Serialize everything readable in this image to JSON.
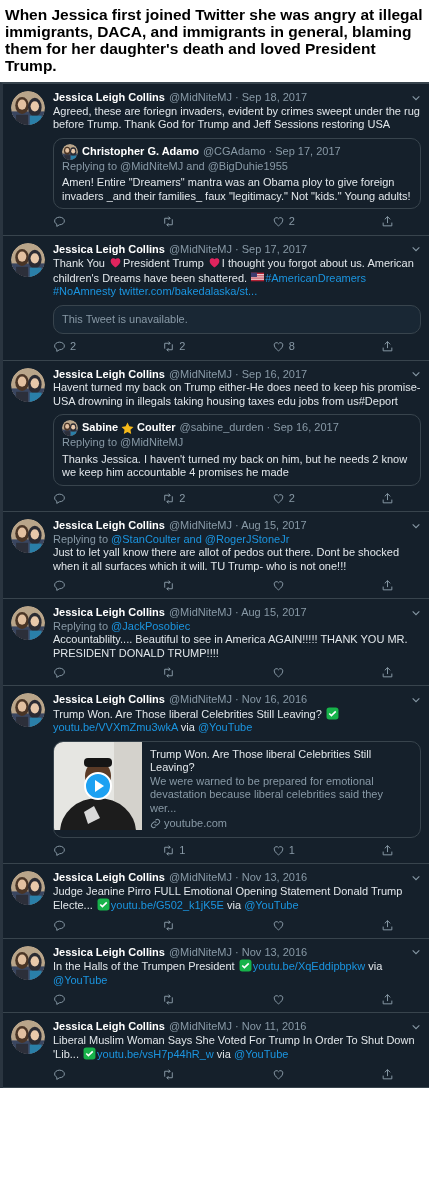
{
  "caption": "When Jessica first joined Twitter she was angry at illegal immigrants, DACA, and immigrants in general, blaming them for her daughter's death and loved President Trump.",
  "tweets": [
    {
      "author": "Jessica Leigh Collins",
      "meta": "@MidNiteMJ · Sep 18, 2017",
      "text": [
        {
          "kind": "text",
          "text": "Agreed, these are foriegn invaders, evident by crimes sweept under the rug before Trump. Thank God for Trump and Jeff Sessions restoring USA"
        }
      ],
      "quote": {
        "author": [
          {
            "kind": "text",
            "text": "Christopher G. Adamo"
          }
        ],
        "meta": "@CGAdamo · Sep 17, 2017",
        "replying": [
          {
            "kind": "text",
            "text": "Replying to @MidNiteMJ and @BigDuhie1955"
          }
        ],
        "text": "Amen! Entire \"Dreamers\" mantra was an Obama ploy to give foreign invaders _and their families_ faux \"legitimacy.\" Not \"kids.\" Young adults!"
      },
      "actions": {
        "likes": "2"
      }
    },
    {
      "author": "Jessica Leigh Collins",
      "meta": "@MidNiteMJ · Sep 17, 2017",
      "text": [
        {
          "kind": "text",
          "text": "Thank You "
        },
        {
          "kind": "heart"
        },
        {
          "kind": "text",
          "text": "President Trump "
        },
        {
          "kind": "heart"
        },
        {
          "kind": "text",
          "text": "I thought you forgot about us. American children's Dreams have been shattered. "
        },
        {
          "kind": "flag"
        },
        {
          "kind": "link",
          "text": "#AmericanDreamers"
        },
        {
          "kind": "link",
          "text": "#NoAmnesty"
        },
        {
          "kind": "link",
          "text": "twitter.com/bakedalaska/st..."
        }
      ],
      "unavailable": "This Tweet is unavailable.",
      "actions": {
        "replies": "2",
        "retweets": "2",
        "likes": "8"
      }
    },
    {
      "author": "Jessica Leigh Collins",
      "meta": "@MidNiteMJ · Sep 16, 2017",
      "text": [
        {
          "kind": "text",
          "text": "Havent turned my back on Trump either-He does need to keep his promise-USA drowning in illegals taking housing taxes edu jobs from us#Deport"
        }
      ],
      "quote": {
        "author": [
          {
            "kind": "text",
            "text": "Sabine "
          },
          {
            "kind": "star"
          },
          {
            "kind": "text",
            "text": "Coulter"
          }
        ],
        "meta": "@sabine_durden · Sep 16, 2017",
        "replying": [
          {
            "kind": "text",
            "text": "Replying to @MidNiteMJ"
          }
        ],
        "text": "Thanks Jessica. I haven't turned my back on him, but he needs 2 know we keep him accountable 4 promises he made"
      },
      "actions": {
        "retweets": "2",
        "likes": "2"
      }
    },
    {
      "author": "Jessica Leigh Collins",
      "meta": "@MidNiteMJ · Aug 15, 2017",
      "replying": [
        {
          "kind": "text",
          "text": "Replying to "
        },
        {
          "kind": "link",
          "text": "@StanCoulter and @RogerJStoneJr"
        }
      ],
      "text": [
        {
          "kind": "text",
          "text": "Just to let yall know there are allot of pedos out there. Dont be shocked when it all surfaces which it will. TU Trump- who is not one!!!"
        }
      ]
    },
    {
      "author": "Jessica Leigh Collins",
      "meta": "@MidNiteMJ · Aug 15, 2017",
      "replying": [
        {
          "kind": "text",
          "text": "Replying to "
        },
        {
          "kind": "link",
          "text": "@JackPosobiec"
        }
      ],
      "text": [
        {
          "kind": "text",
          "text": "Accountablilty.... Beautiful to see in America AGAIN!!!!! THANK YOU MR. PRESIDENT DONALD TRUMP!!!!"
        }
      ]
    },
    {
      "author": "Jessica Leigh Collins",
      "meta": "@MidNiteMJ · Nov 16, 2016",
      "text": [
        {
          "kind": "text",
          "text": "Trump Won. Are Those liberal Celebrities Still Leaving? "
        },
        {
          "kind": "check"
        },
        {
          "kind": "link",
          "text": "youtu.be/VVXmZmu3wkA"
        },
        {
          "kind": "text",
          "text": " via "
        },
        {
          "kind": "link",
          "text": "@YouTube"
        }
      ],
      "card": {
        "kind": "video",
        "title": "Trump Won. Are Those liberal Celebrities Still Leaving?",
        "description": "We were warned to be prepared for emotional devastation because liberal celebrities said they wer...",
        "domain": "youtube.com"
      },
      "actions": {
        "retweets": "1",
        "likes": "1"
      }
    },
    {
      "author": "Jessica Leigh Collins",
      "meta": "@MidNiteMJ · Nov 13, 2016",
      "text": [
        {
          "kind": "text",
          "text": "Judge Jeanine Pirro FULL Emotional Opening Statement Donald Trump Electe... "
        },
        {
          "kind": "check"
        },
        {
          "kind": "link",
          "text": "youtu.be/G502_k1jK5E"
        },
        {
          "kind": "text",
          "text": " via "
        },
        {
          "kind": "link",
          "text": "@YouTube"
        }
      ]
    },
    {
      "author": "Jessica Leigh Collins",
      "meta": "@MidNiteMJ · Nov 13, 2016",
      "text": [
        {
          "kind": "text",
          "text": "In the Halls of the Trumpen President "
        },
        {
          "kind": "check"
        },
        {
          "kind": "link",
          "text": "youtu.be/XqEddipbpkw"
        },
        {
          "kind": "text",
          "text": " via "
        },
        {
          "kind": "link",
          "text": "@YouTube"
        }
      ]
    },
    {
      "author": "Jessica Leigh Collins",
      "meta": "@MidNiteMJ · Nov 11, 2016",
      "text": [
        {
          "kind": "text",
          "text": "Liberal Muslim Woman Says She Voted For Trump In Order To Shut Down 'Lib... "
        },
        {
          "kind": "check"
        },
        {
          "kind": "link",
          "text": "youtu.be/vsH7p44hR_w"
        },
        {
          "kind": "text",
          "text": " via "
        },
        {
          "kind": "link",
          "text": "@YouTube"
        }
      ]
    }
  ]
}
